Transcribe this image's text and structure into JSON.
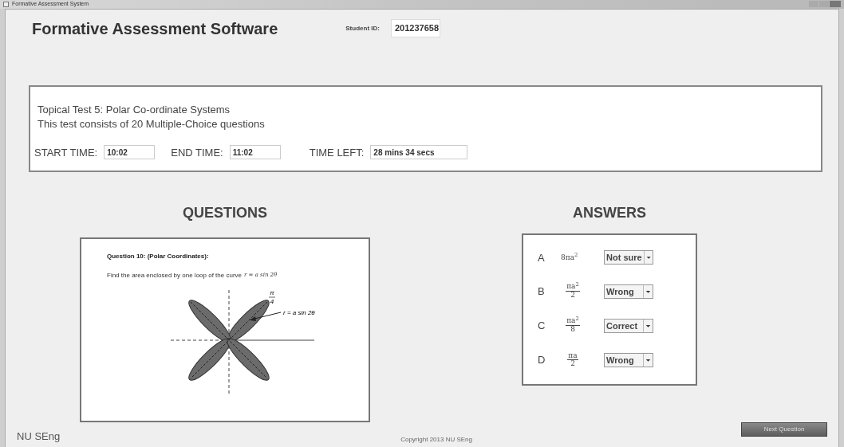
{
  "window": {
    "title": "Formative Assessment System"
  },
  "header": {
    "title": "Formative Assessment Software",
    "student_id_label": "Student ID:",
    "student_id": "201237658"
  },
  "test_info": {
    "title": "Topical Test 5: Polar Co-ordinate Systems",
    "description": "This test consists of 20 Multiple-Choice questions",
    "times": [
      {
        "label": "START TIME:",
        "value": "10:02",
        "kind": "short"
      },
      {
        "label": "END TIME:",
        "value": "11:02",
        "kind": "short"
      },
      {
        "label": "TIME LEFT:",
        "value": "28 mins 34 secs",
        "kind": "long"
      }
    ]
  },
  "questions": {
    "heading": "QUESTIONS",
    "question_title": "Question 10: (Polar Coordinates):",
    "prompt": "Find the area enclosed by one loop of the curve",
    "prompt_formula": "r = a sin 2θ",
    "angle_numerator": "π",
    "angle_denominator": "4",
    "curve_label": "r = a sin 2θ"
  },
  "answers": {
    "heading": "ANSWERS",
    "options": [
      {
        "letter": "A",
        "kind": "inline",
        "expression": "8πa$^{2}$",
        "judgement": "Not sure"
      },
      {
        "letter": "B",
        "kind": "fraction",
        "numerator": "πa$^{2}$",
        "denominator": "2",
        "judgement": "Wrong"
      },
      {
        "letter": "C",
        "kind": "fraction",
        "numerator": "πa$^{2}$",
        "denominator": "8",
        "judgement": "Correct"
      },
      {
        "letter": "D",
        "kind": "fraction",
        "numerator": "πa",
        "denominator": "2",
        "judgement": "Wrong"
      }
    ]
  },
  "footer": {
    "brand": "NU SEng",
    "copyright": "Copyright 2013 NU SEng",
    "next_button": "Next Question"
  }
}
